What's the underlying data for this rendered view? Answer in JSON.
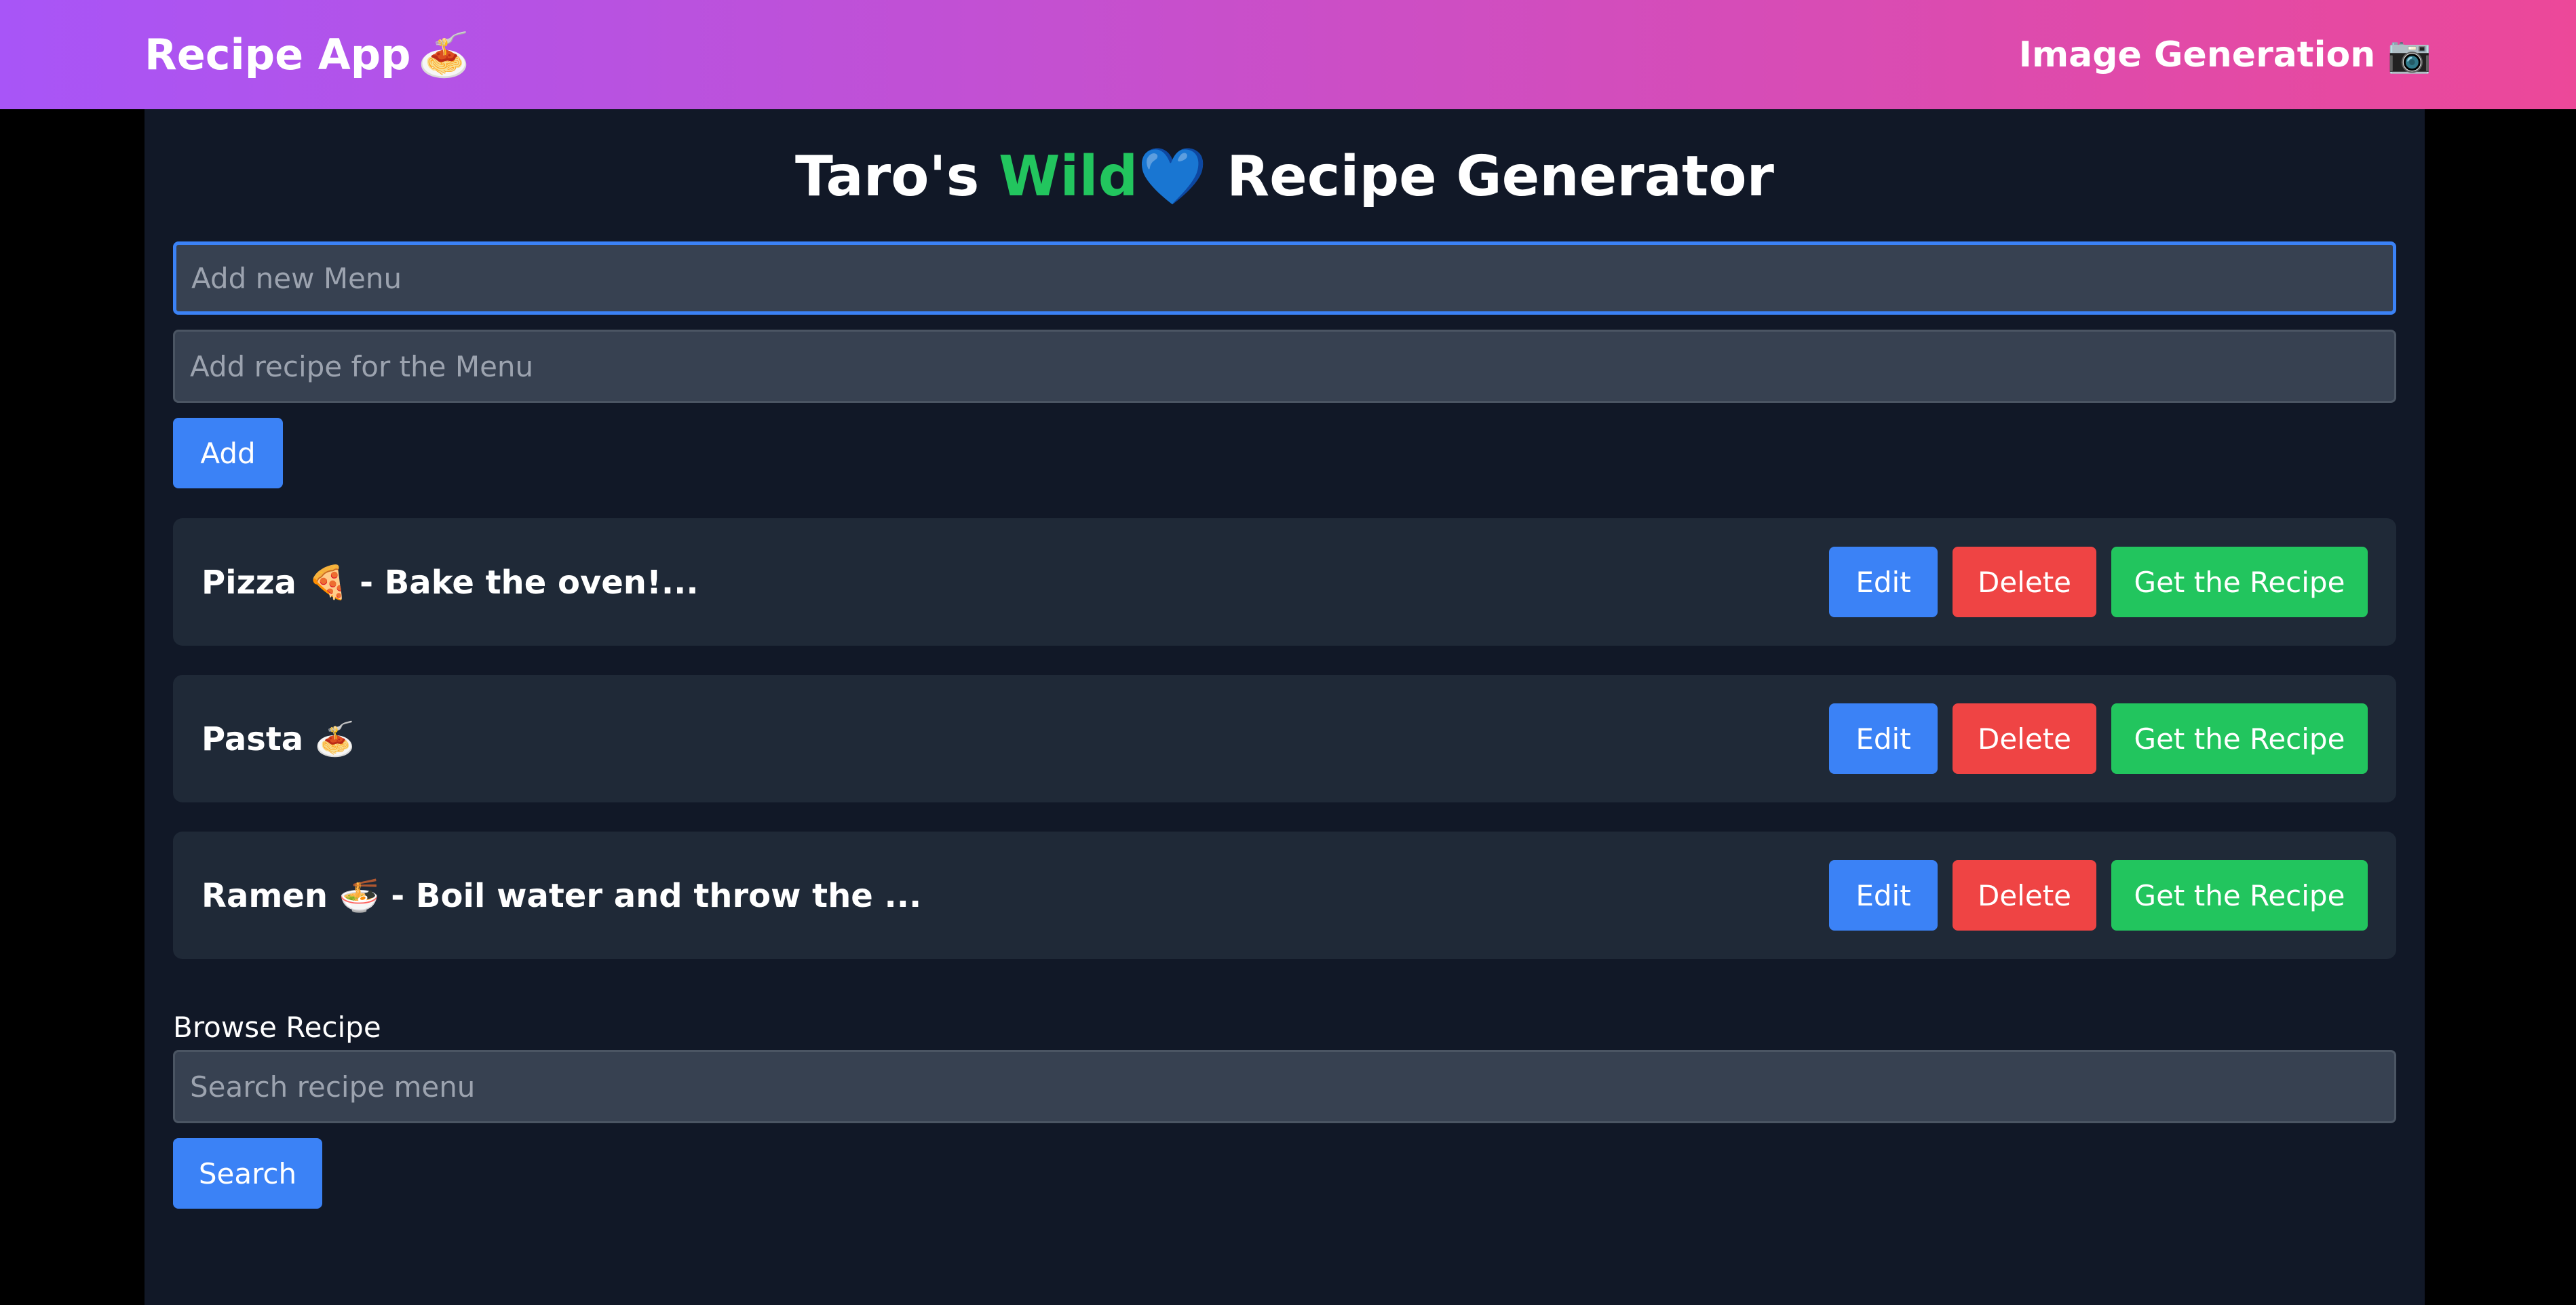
{
  "navbar": {
    "brand": "Recipe App",
    "brand_emoji": "🍝",
    "link_label": "Image Generation",
    "link_emoji": "📷"
  },
  "title": {
    "prefix": "Taro's ",
    "wild": "Wild",
    "heart": "💙",
    "suffix": " Recipe Generator"
  },
  "form": {
    "menu_placeholder": "Add new Menu",
    "recipe_placeholder": "Add recipe for the Menu",
    "add_label": "Add"
  },
  "menus": [
    {
      "text": "Pizza 🍕 - Bake the oven!..."
    },
    {
      "text": "Pasta 🍝"
    },
    {
      "text": "Ramen 🍜 - Boil water and throw the ..."
    }
  ],
  "actions": {
    "edit_label": "Edit",
    "delete_label": "Delete",
    "recipe_label": "Get the Recipe"
  },
  "browse": {
    "label": "Browse Recipe",
    "search_placeholder": "Search recipe menu",
    "search_label": "Search"
  },
  "colors": {
    "gradient_start": "#a855f7",
    "gradient_end": "#ec4899",
    "background": "#111827",
    "card": "#1f2937",
    "blue": "#3b82f6",
    "red": "#ef4444",
    "green": "#22c55e"
  }
}
